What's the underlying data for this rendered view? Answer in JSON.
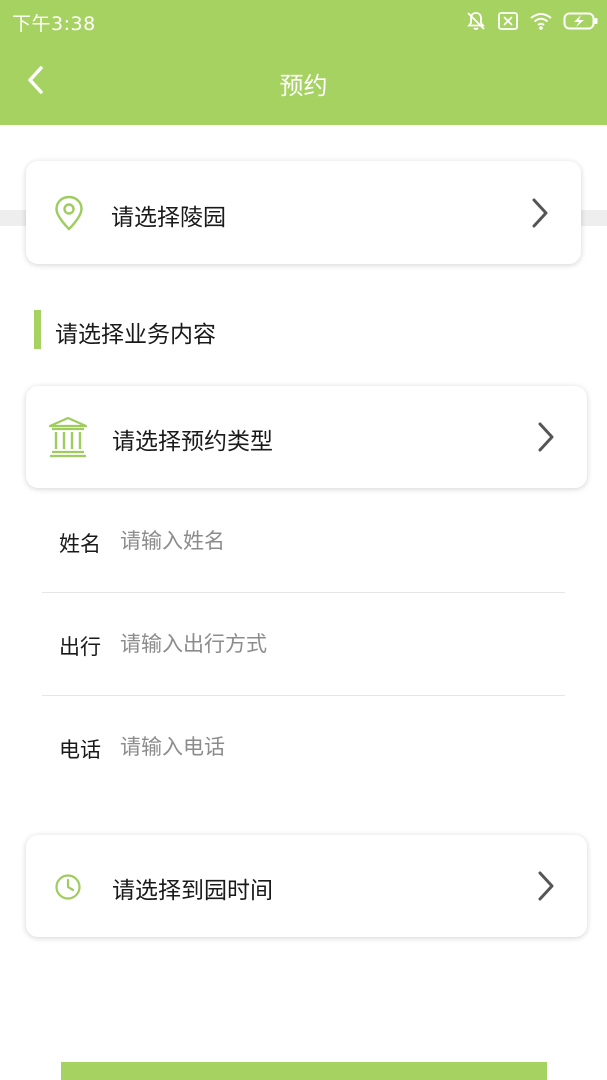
{
  "status_bar": {
    "time": "下午3:38",
    "icons": [
      "mute-bell-icon",
      "sim-off-icon",
      "wifi-icon",
      "battery-charging-icon"
    ]
  },
  "nav": {
    "title": "预约",
    "back_icon": "chevron-left-icon"
  },
  "cemetery_selector": {
    "label": "请选择陵园",
    "icon": "location-pin-icon"
  },
  "section": {
    "title": "请选择业务内容"
  },
  "type_selector": {
    "label": "请选择预约类型",
    "icon": "building-icon"
  },
  "form": {
    "name": {
      "label": "姓名",
      "placeholder": "请输入姓名",
      "value": ""
    },
    "travel": {
      "label": "出行",
      "placeholder": "请输入出行方式",
      "value": ""
    },
    "phone": {
      "label": "电话",
      "placeholder": "请输入电话",
      "value": ""
    }
  },
  "time_selector": {
    "label": "请选择到园时间",
    "icon": "clock-icon"
  },
  "colors": {
    "accent": "#a6d262",
    "icon_green": "#9fcc5f",
    "text": "#1a1a1a",
    "placeholder": "#8c8c8c"
  }
}
